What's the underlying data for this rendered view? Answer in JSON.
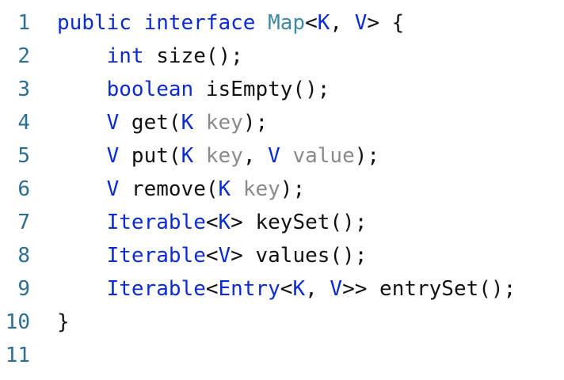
{
  "editor": {
    "line_numbers": [
      "1",
      "2",
      "3",
      "4",
      "5",
      "6",
      "7",
      "8",
      "9",
      "10",
      "11"
    ],
    "lines": [
      [
        {
          "t": "public interface ",
          "k": "kw"
        },
        {
          "t": "Map",
          "k": "type"
        },
        {
          "t": "<",
          "k": "plain"
        },
        {
          "t": "K",
          "k": "tv"
        },
        {
          "t": ", ",
          "k": "plain"
        },
        {
          "t": "V",
          "k": "tv"
        },
        {
          "t": "> {",
          "k": "plain"
        }
      ],
      [
        {
          "t": "    ",
          "k": "plain"
        },
        {
          "t": "int",
          "k": "kw"
        },
        {
          "t": " size();",
          "k": "plain"
        }
      ],
      [
        {
          "t": "    ",
          "k": "plain"
        },
        {
          "t": "boolean",
          "k": "kw"
        },
        {
          "t": " isEmpty();",
          "k": "plain"
        }
      ],
      [
        {
          "t": "    ",
          "k": "plain"
        },
        {
          "t": "V",
          "k": "tv"
        },
        {
          "t": " get(",
          "k": "plain"
        },
        {
          "t": "K",
          "k": "tv"
        },
        {
          "t": " ",
          "k": "plain"
        },
        {
          "t": "key",
          "k": "param"
        },
        {
          "t": ");",
          "k": "plain"
        }
      ],
      [
        {
          "t": "    ",
          "k": "plain"
        },
        {
          "t": "V",
          "k": "tv"
        },
        {
          "t": " put(",
          "k": "plain"
        },
        {
          "t": "K",
          "k": "tv"
        },
        {
          "t": " ",
          "k": "plain"
        },
        {
          "t": "key",
          "k": "param"
        },
        {
          "t": ", ",
          "k": "plain"
        },
        {
          "t": "V",
          "k": "tv"
        },
        {
          "t": " ",
          "k": "plain"
        },
        {
          "t": "value",
          "k": "param"
        },
        {
          "t": ");",
          "k": "plain"
        }
      ],
      [
        {
          "t": "    ",
          "k": "plain"
        },
        {
          "t": "V",
          "k": "tv"
        },
        {
          "t": " remove(",
          "k": "plain"
        },
        {
          "t": "K",
          "k": "tv"
        },
        {
          "t": " ",
          "k": "plain"
        },
        {
          "t": "key",
          "k": "param"
        },
        {
          "t": ");",
          "k": "plain"
        }
      ],
      [
        {
          "t": "    ",
          "k": "plain"
        },
        {
          "t": "Iterable",
          "k": "kw"
        },
        {
          "t": "<",
          "k": "plain"
        },
        {
          "t": "K",
          "k": "tv"
        },
        {
          "t": "> keySet();",
          "k": "plain"
        }
      ],
      [
        {
          "t": "    ",
          "k": "plain"
        },
        {
          "t": "Iterable",
          "k": "kw"
        },
        {
          "t": "<",
          "k": "plain"
        },
        {
          "t": "V",
          "k": "tv"
        },
        {
          "t": "> values();",
          "k": "plain"
        }
      ],
      [
        {
          "t": "    ",
          "k": "plain"
        },
        {
          "t": "Iterable",
          "k": "kw"
        },
        {
          "t": "<",
          "k": "plain"
        },
        {
          "t": "Entry",
          "k": "kw"
        },
        {
          "t": "<",
          "k": "plain"
        },
        {
          "t": "K",
          "k": "tv"
        },
        {
          "t": ", ",
          "k": "plain"
        },
        {
          "t": "V",
          "k": "tv"
        },
        {
          "t": ">> entrySet();",
          "k": "plain"
        }
      ],
      [
        {
          "t": "}",
          "k": "plain"
        }
      ],
      []
    ]
  },
  "colors": {
    "keyword": "#0b2bd4",
    "type_variable": "#0b2bd4",
    "type_name": "#3e8aa6",
    "parameter": "#8a8a8a",
    "plain_text": "#111111",
    "line_number": "#2c6f95",
    "background": "#ffffff"
  }
}
